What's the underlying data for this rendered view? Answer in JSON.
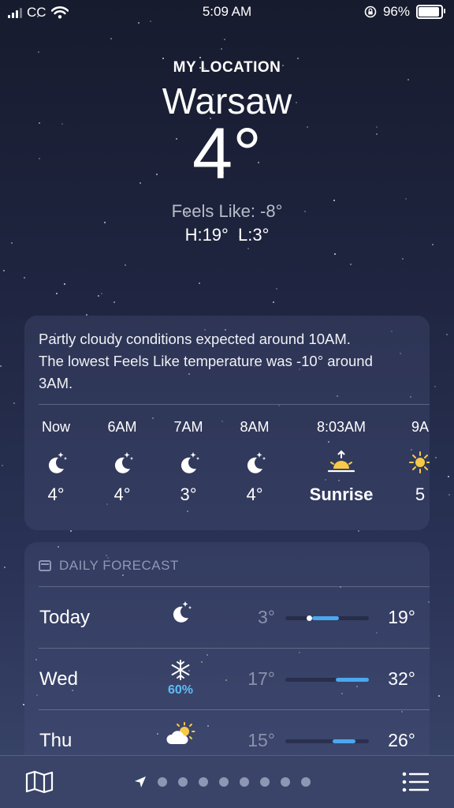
{
  "status_bar": {
    "carrier": "CC",
    "time": "5:09 AM",
    "battery": "96%"
  },
  "location": {
    "label": "MY LOCATION",
    "city": "Warsaw",
    "temp": "4°",
    "feels_like": "Feels Like: -8°",
    "hi_lo": "H:19°  L:3°"
  },
  "hourly": {
    "summary_line1": "Partly cloudy conditions expected around 10AM.",
    "summary_line2": "The lowest Feels Like temperature was -10° around",
    "summary_line3": "3AM.",
    "items": [
      {
        "time": "Now",
        "icon": "moon-stars-icon",
        "value": "4°"
      },
      {
        "time": "6AM",
        "icon": "moon-stars-icon",
        "value": "4°"
      },
      {
        "time": "7AM",
        "icon": "moon-stars-icon",
        "value": "3°"
      },
      {
        "time": "8AM",
        "icon": "moon-stars-icon",
        "value": "4°"
      },
      {
        "time": "8:03AM",
        "icon": "sunrise-icon",
        "value": "Sunrise"
      },
      {
        "time": "9A",
        "icon": "sun-icon",
        "value": "5"
      }
    ]
  },
  "daily": {
    "title": "DAILY FORECAST",
    "days": [
      {
        "name": "Today",
        "icon": "moon-stars-icon",
        "precip": "",
        "low": "3°",
        "high": "19°",
        "range_start": 0.32,
        "range_end": 0.64,
        "current": 0.28
      },
      {
        "name": "Wed",
        "icon": "snowflake-icon",
        "precip": "60%",
        "low": "17°",
        "high": "32°",
        "range_start": 0.6,
        "range_end": 1.0
      },
      {
        "name": "Thu",
        "icon": "partly-cloudy-icon",
        "precip": "",
        "low": "15°",
        "high": "26°",
        "range_start": 0.57,
        "range_end": 0.84
      }
    ]
  },
  "bottom_bar": {
    "page_count": 8
  },
  "colors": {
    "accent_blue": "#4aa8f0",
    "precip_blue": "#5dbdf5",
    "sun_yellow": "#f7c948"
  }
}
